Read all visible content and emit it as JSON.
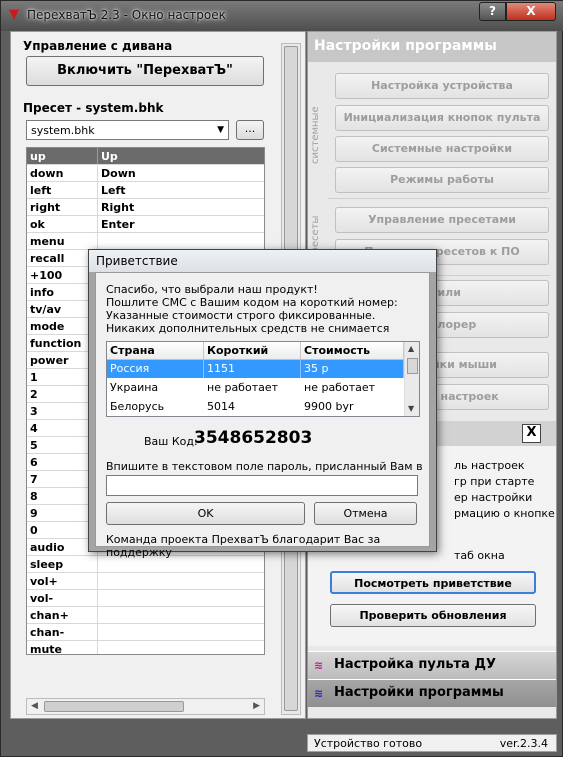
{
  "window": {
    "title": "ПерехватЪ 2.3 - Окно настроек",
    "help_label": "?",
    "close_label": "X"
  },
  "left": {
    "couch_title": "Управление с дивана",
    "enable_label": "Включить \"ПерехватЪ\"",
    "preset_title": "Пресет - system.bhk",
    "preset_value": "system.bhk",
    "browse_label": "...",
    "rows": [
      {
        "k": "up",
        "v": "Up"
      },
      {
        "k": "down",
        "v": "Down"
      },
      {
        "k": "left",
        "v": "Left"
      },
      {
        "k": "right",
        "v": "Right"
      },
      {
        "k": "ok",
        "v": "Enter"
      },
      {
        "k": "menu",
        "v": ""
      },
      {
        "k": "recall",
        "v": ""
      },
      {
        "k": "+100",
        "v": ""
      },
      {
        "k": "info",
        "v": ""
      },
      {
        "k": "tv/av",
        "v": ""
      },
      {
        "k": "mode",
        "v": ""
      },
      {
        "k": "function",
        "v": ""
      },
      {
        "k": "power",
        "v": ""
      },
      {
        "k": "1",
        "v": ""
      },
      {
        "k": "2",
        "v": ""
      },
      {
        "k": "3",
        "v": ""
      },
      {
        "k": "4",
        "v": ""
      },
      {
        "k": "5",
        "v": ""
      },
      {
        "k": "6",
        "v": ""
      },
      {
        "k": "7",
        "v": ""
      },
      {
        "k": "8",
        "v": ""
      },
      {
        "k": "9",
        "v": ""
      },
      {
        "k": "0",
        "v": ""
      },
      {
        "k": "audio",
        "v": ""
      },
      {
        "k": "sleep",
        "v": ""
      },
      {
        "k": "vol+",
        "v": ""
      },
      {
        "k": "vol-",
        "v": ""
      },
      {
        "k": "chan+",
        "v": ""
      },
      {
        "k": "chan-",
        "v": ""
      },
      {
        "k": "mute",
        "v": ""
      }
    ]
  },
  "right": {
    "header": "Настройки программы",
    "side_system": "системные",
    "side_presets": "пресеты",
    "buttons": [
      "Настройка устройства",
      "Инициализация кнопок пульта ДУ",
      "Системные настройки",
      "Режимы работы",
      "Управление пресетами",
      "Привязка пресетов к ПО",
      "Стили",
      "Эксплорер",
      "Настройки мыши",
      "Экспорт настроек"
    ],
    "panel_close": "X",
    "panel_lines": [
      "ль настроек",
      "гр при старте",
      "ер настройки",
      "рмацию о кнопке",
      "таб окна"
    ],
    "view_welcome": "Посмотреть приветствие",
    "check_updates": "Проверить обновления",
    "nav_remote": "Настройка пульта ДУ",
    "nav_settings": "Настройки программы"
  },
  "status": {
    "text": "Устройство готово",
    "version": "ver.2.3.4"
  },
  "dialog": {
    "title": "Приветствие",
    "message": [
      "Спасибо, что выбрали наш продукт!",
      "Пошлите СМС с Вашим кодом на короткий номер:",
      "Указанные стоимости строго фиксированные.",
      "Никаких дополнительных средств не снимается"
    ],
    "columns": [
      "Страна",
      "Короткий номер",
      "Стоимость"
    ],
    "rows": [
      [
        "Россия",
        "1151",
        "35 р"
      ],
      [
        "Украина",
        "не работает",
        "не работает"
      ],
      [
        "Белорусь",
        "5014",
        "9900 byr"
      ]
    ],
    "code_label": "Ваш Код:",
    "code_value": "3548652803",
    "hint": "Впишите в текстовом поле пароль, присланный Вам в ответ",
    "ok_label": "OK",
    "cancel_label": "Отмена",
    "thanks": "Команда проекта ПрехватЪ благодарит Вас за поддержку"
  },
  "colors": {
    "selection": "#3399ff",
    "grid_header": "#6b6b6b",
    "icon_wifi": "#c0208c"
  }
}
